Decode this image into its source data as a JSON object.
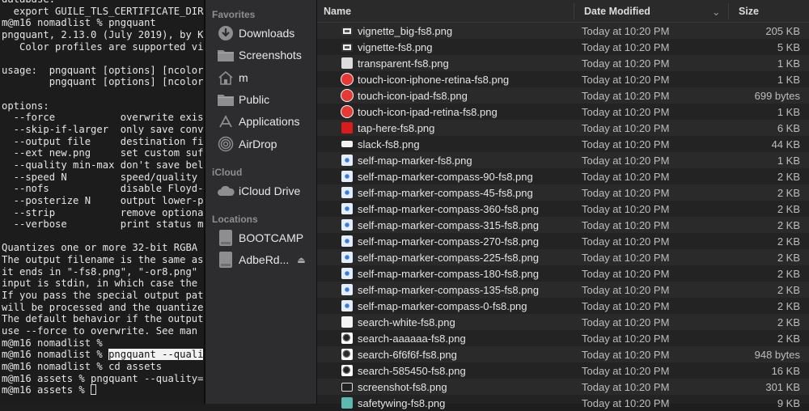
{
  "terminal": {
    "lines": [
      "database:",
      "  export GUILE_TLS_CERTIFICATE_DIR",
      "m@m16 nomadlist % pngquant",
      "pngquant, 2.13.0 (July 2019), by K",
      "   Color profiles are supported vi",
      "",
      "usage:  pngquant [options] [ncolor",
      "        pngquant [options] [ncolor",
      "",
      "options:",
      "  --force           overwrite exis",
      "  --skip-if-larger  only save conv",
      "  --output file     destination fi",
      "  --ext new.png     set custom suf",
      "  --quality min-max don't save bel",
      "  --speed N         speed/quality ",
      "  --nofs            disable Floyd-",
      "  --posterize N     output lower-p",
      "  --strip           remove optiona",
      "  --verbose         print status m",
      "",
      "Quantizes one or more 32-bit RGBA ",
      "The output filename is the same as",
      "it ends in \"-fs8.png\", \"-or8.png\" ",
      "input is stdin, in which case the ",
      "If you pass the special output pat",
      "will be processed and the quantize",
      "The default behavior if the output",
      "use --force to overwrite. See man ",
      "m@m16 nomadlist %",
      "m@m16 nomadlist % ",
      "m@m16 nomadlist % cd assets",
      "m@m16 assets % pngquant --quality=",
      "m@m16 assets % "
    ],
    "highlighted_command": "pngquant --quali"
  },
  "sidebar": {
    "favorites_label": "Favorites",
    "favorites": [
      {
        "label": "Downloads",
        "icon": "download-icon"
      },
      {
        "label": "Screenshots",
        "icon": "folder-icon"
      },
      {
        "label": "m",
        "icon": "home-icon"
      },
      {
        "label": "Public",
        "icon": "folder-icon"
      },
      {
        "label": "Applications",
        "icon": "applications-icon"
      },
      {
        "label": "AirDrop",
        "icon": "airdrop-icon"
      }
    ],
    "icloud_label": "iCloud",
    "icloud": [
      {
        "label": "iCloud Drive",
        "icon": "cloud-icon"
      }
    ],
    "locations_label": "Locations",
    "locations": [
      {
        "label": "BOOTCAMP",
        "icon": "disk-icon"
      },
      {
        "label": "AdbeRd...",
        "icon": "disk-icon"
      }
    ]
  },
  "list": {
    "columns": {
      "name": "Name",
      "date": "Date Modified",
      "size": "Size"
    },
    "files": [
      {
        "name": "vignette_big-fs8.png",
        "date": "Today at 10:20 PM",
        "size": "205 KB",
        "icon": "vignette"
      },
      {
        "name": "vignette-fs8.png",
        "date": "Today at 10:20 PM",
        "size": "5 KB",
        "icon": "vignette"
      },
      {
        "name": "transparent-fs8.png",
        "date": "Today at 10:20 PM",
        "size": "1 KB",
        "icon": "blank"
      },
      {
        "name": "touch-icon-iphone-retina-fs8.png",
        "date": "Today at 10:20 PM",
        "size": "1 KB",
        "icon": "touch"
      },
      {
        "name": "touch-icon-ipad-fs8.png",
        "date": "Today at 10:20 PM",
        "size": "699 bytes",
        "icon": "touch"
      },
      {
        "name": "touch-icon-ipad-retina-fs8.png",
        "date": "Today at 10:20 PM",
        "size": "1 KB",
        "icon": "touch"
      },
      {
        "name": "tap-here-fs8.png",
        "date": "Today at 10:20 PM",
        "size": "6 KB",
        "icon": "tap"
      },
      {
        "name": "slack-fs8.png",
        "date": "Today at 10:20 PM",
        "size": "44 KB",
        "icon": "slack"
      },
      {
        "name": "self-map-marker-fs8.png",
        "date": "Today at 10:20 PM",
        "size": "1 KB",
        "icon": "marker"
      },
      {
        "name": "self-map-marker-compass-90-fs8.png",
        "date": "Today at 10:20 PM",
        "size": "2 KB",
        "icon": "marker"
      },
      {
        "name": "self-map-marker-compass-45-fs8.png",
        "date": "Today at 10:20 PM",
        "size": "2 KB",
        "icon": "marker"
      },
      {
        "name": "self-map-marker-compass-360-fs8.png",
        "date": "Today at 10:20 PM",
        "size": "2 KB",
        "icon": "marker"
      },
      {
        "name": "self-map-marker-compass-315-fs8.png",
        "date": "Today at 10:20 PM",
        "size": "2 KB",
        "icon": "marker"
      },
      {
        "name": "self-map-marker-compass-270-fs8.png",
        "date": "Today at 10:20 PM",
        "size": "2 KB",
        "icon": "marker"
      },
      {
        "name": "self-map-marker-compass-225-fs8.png",
        "date": "Today at 10:20 PM",
        "size": "2 KB",
        "icon": "marker"
      },
      {
        "name": "self-map-marker-compass-180-fs8.png",
        "date": "Today at 10:20 PM",
        "size": "2 KB",
        "icon": "marker"
      },
      {
        "name": "self-map-marker-compass-135-fs8.png",
        "date": "Today at 10:20 PM",
        "size": "2 KB",
        "icon": "marker"
      },
      {
        "name": "self-map-marker-compass-0-fs8.png",
        "date": "Today at 10:20 PM",
        "size": "2 KB",
        "icon": "marker"
      },
      {
        "name": "search-white-fs8.png",
        "date": "Today at 10:20 PM",
        "size": "2 KB",
        "icon": "white"
      },
      {
        "name": "search-aaaaaa-fs8.png",
        "date": "Today at 10:20 PM",
        "size": "2 KB",
        "icon": "search"
      },
      {
        "name": "search-6f6f6f-fs8.png",
        "date": "Today at 10:20 PM",
        "size": "948 bytes",
        "icon": "search"
      },
      {
        "name": "search-585450-fs8.png",
        "date": "Today at 10:20 PM",
        "size": "16 KB",
        "icon": "search"
      },
      {
        "name": "screenshot-fs8.png",
        "date": "Today at 10:20 PM",
        "size": "301 KB",
        "icon": "screenshot"
      },
      {
        "name": "safetywing-fs8.png",
        "date": "Today at 10:20 PM",
        "size": "9 KB",
        "icon": "safetywing"
      }
    ]
  }
}
